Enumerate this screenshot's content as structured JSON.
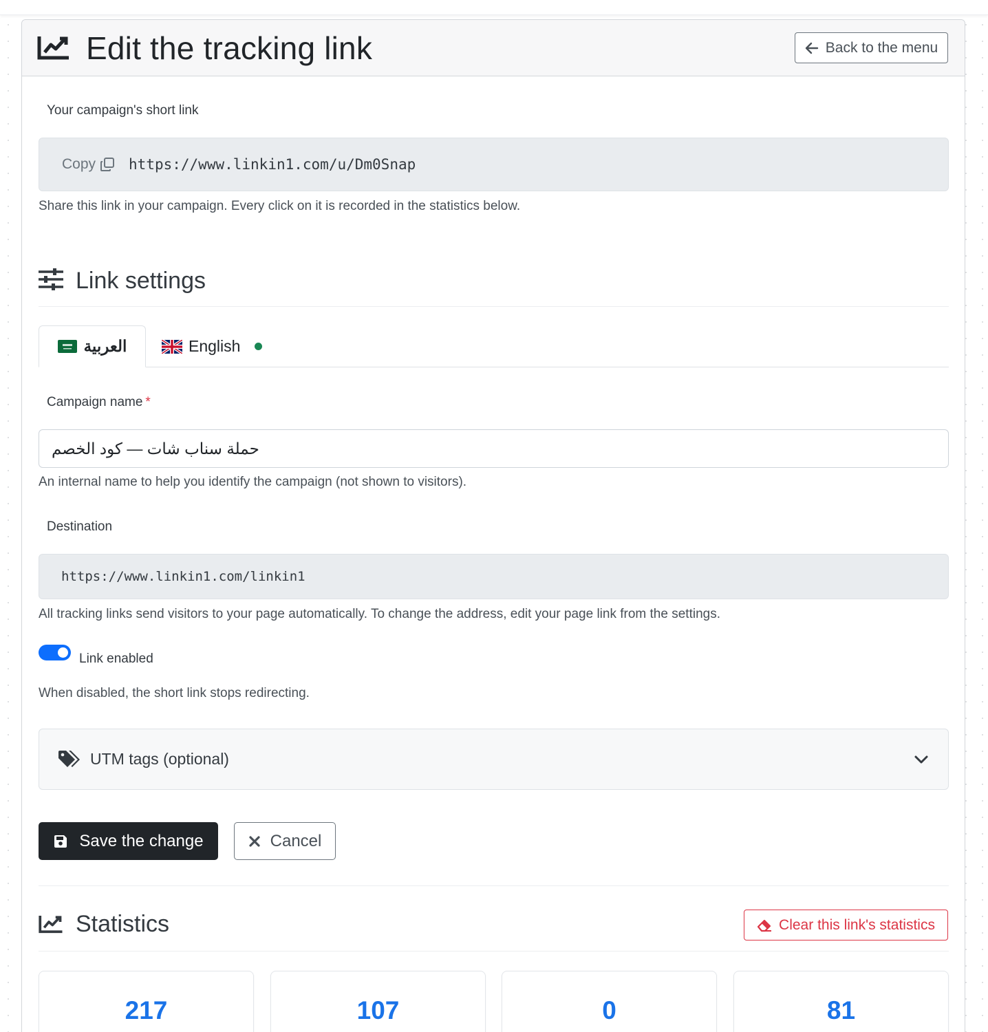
{
  "header": {
    "title": "Edit the tracking link",
    "back_label": "Back to the menu"
  },
  "short_link": {
    "label": "Your campaign's short link",
    "copy_label": "Copy",
    "url": "https://www.linkin1.com/u/Dm0Snap",
    "help": "Share this link in your campaign. Every click on it is recorded in the statistics below."
  },
  "settings": {
    "title": "Link settings",
    "tabs": [
      {
        "label": "العربية",
        "flag": "saudi-flag-icon",
        "active": true
      },
      {
        "label": "English",
        "flag": "uk-flag-icon",
        "active": false,
        "status": "green"
      }
    ],
    "campaign_name": {
      "label": "Campaign name",
      "required_mark": "*",
      "value": "حملة سناب شات — كود الخصم",
      "help": "An internal name to help you identify the campaign (not shown to visitors)."
    },
    "destination": {
      "label": "Destination",
      "value": "https://www.linkin1.com/linkin1",
      "help": "All tracking links send visitors to your page automatically. To change the address, edit your page link from the settings."
    },
    "toggle": {
      "label": "Link enabled",
      "enabled": true,
      "help": "When disabled, the short link stops redirecting."
    },
    "utm": {
      "label": "UTM tags (optional)",
      "icon": "tags-icon",
      "expanded": false
    }
  },
  "actions": {
    "save_label": "Save the change",
    "cancel_label": "Cancel"
  },
  "statistics": {
    "title": "Statistics",
    "clear_label": "Clear this link's statistics",
    "values": [
      "217",
      "107",
      "0",
      "81"
    ]
  },
  "colors": {
    "primary": "#0d6efd",
    "danger": "#dc3545",
    "dark": "#212529",
    "stat_blue": "#1a73e8",
    "success": "#198754"
  }
}
